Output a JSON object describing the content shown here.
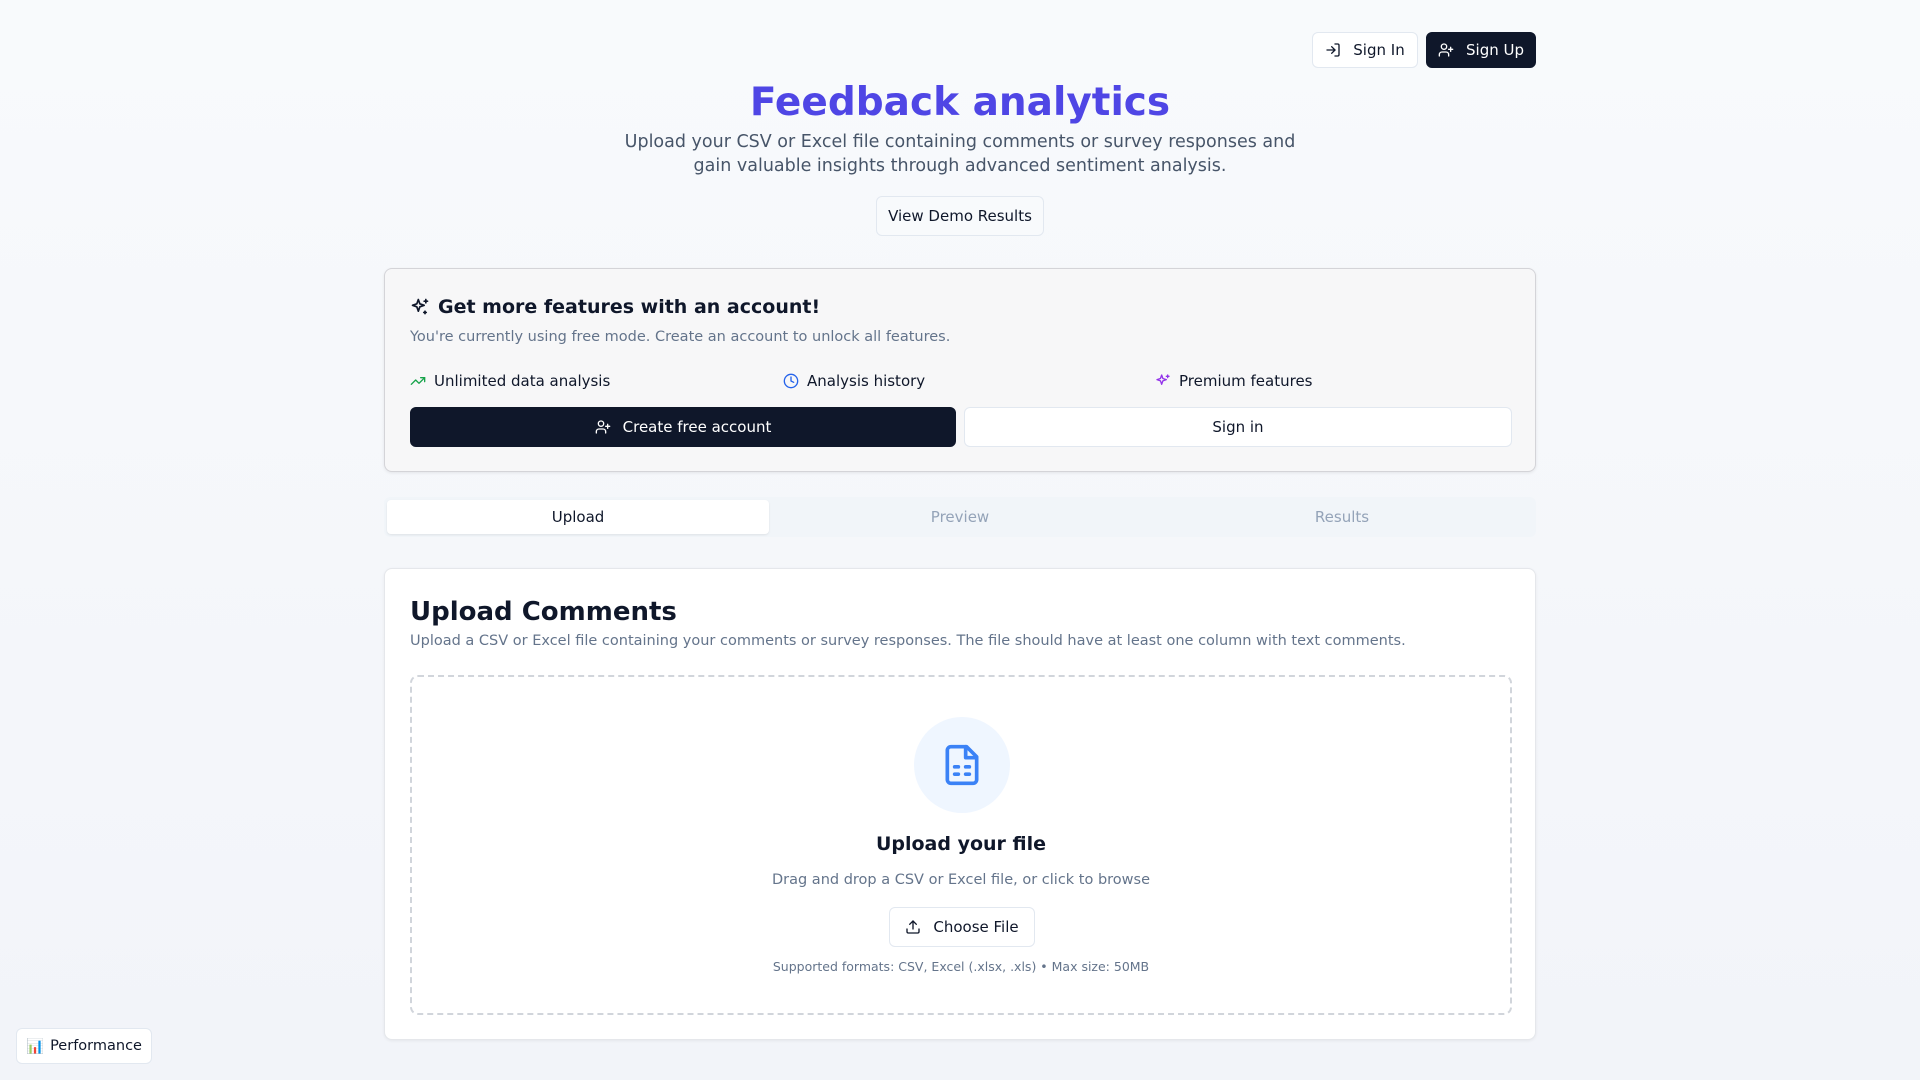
{
  "header": {
    "sign_in_label": "Sign In",
    "sign_up_label": "Sign Up"
  },
  "hero": {
    "title": "Feedback analytics",
    "subtitle": "Upload your CSV or Excel file containing comments or survey responses and gain valuable insights through advanced sentiment analysis.",
    "demo_button_label": "View Demo Results"
  },
  "promo": {
    "title": "Get more features with an account!",
    "description": "You're currently using free mode. Create an account to unlock all features.",
    "features": [
      {
        "label": "Unlimited data analysis",
        "icon": "trending-up-icon",
        "color": "#16a34a"
      },
      {
        "label": "Analysis history",
        "icon": "clock-icon",
        "color": "#2563eb"
      },
      {
        "label": "Premium features",
        "icon": "sparkles-icon",
        "color": "#9333ea"
      }
    ],
    "create_account_label": "Create free account",
    "sign_in_label": "Sign in"
  },
  "tabs": [
    {
      "label": "Upload",
      "active": true
    },
    {
      "label": "Preview",
      "active": false
    },
    {
      "label": "Results",
      "active": false
    }
  ],
  "upload": {
    "title": "Upload Comments",
    "description": "Upload a CSV or Excel file containing your comments or survey responses. The file should have at least one column with text comments.",
    "dropzone_title": "Upload your file",
    "dropzone_description": "Drag and drop a CSV or Excel file, or click to browse",
    "choose_file_label": "Choose File",
    "supported_formats": "Supported formats: CSV, Excel (.xlsx, .xls) • Max size: 50MB"
  },
  "performance_widget": {
    "label": "Performance",
    "icon": "📊"
  },
  "colors": {
    "accent": "#4f46e5",
    "primary_dark": "#0f172a",
    "file_icon": "#3b82f6"
  }
}
